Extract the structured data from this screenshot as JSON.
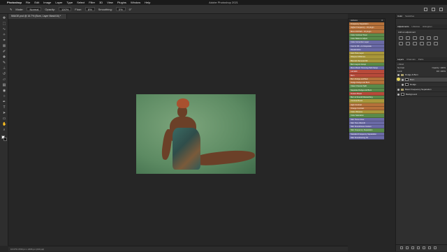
{
  "menubar": {
    "apple": "",
    "items": [
      "Photoshop",
      "File",
      "Edit",
      "Image",
      "Layer",
      "Type",
      "Select",
      "Filter",
      "3D",
      "View",
      "Plugins",
      "Window",
      "Help"
    ],
    "app_title": "Adobe Photoshop 2021"
  },
  "options_bar": {
    "mode_label": "Mode:",
    "mode_value": "Normal",
    "opacity_label": "Opacity:",
    "opacity_value": "100%",
    "flow_label": "Flow:",
    "flow_value": "8%",
    "smoothing_label": "Smoothing:",
    "smoothing_value": "0%",
    "angle_value": "0°"
  },
  "document": {
    "tab_title": "IMAGE.psd @ 16.7% (Burn, Layer Mask/16) *",
    "status": "16.67%   3700 px x 2466 px (240 ppi)"
  },
  "actions_panel": {
    "title": "Actions",
    "items": [
      {
        "label": "Frequency Separation",
        "color": "#b5713a"
      },
      {
        "label": "Higher Frequency - 16 plugin",
        "color": "#b5713a"
      },
      {
        "label": "Mono Fill Path - 16 plugin",
        "color": "#b5713a"
      },
      {
        "label": "Color Contrast Toner",
        "color": "#5a8a4a"
      },
      {
        "label": "Color Balance Adjust",
        "color": "#5a8a4a"
      },
      {
        "label": "Color Correction Layer",
        "color": "#6a6aa6"
      },
      {
        "label": "Cool to Fill + to Grayscale",
        "color": "#6a6aa6"
      },
      {
        "label": "Desaturation",
        "color": "#6a6aa6"
      },
      {
        "label": "Auto Tone Layer",
        "color": "#a8963a"
      },
      {
        "label": "Sharpen Midtones",
        "color": "#a8963a"
      },
      {
        "label": "Blemish Removal Fill",
        "color": "#a8963a"
      },
      {
        "label": "Burn Layers Group",
        "color": "#5a8a4a"
      },
      {
        "label": "Mono Brush Trimming Path Setup",
        "color": "#6a6aa6"
      },
      {
        "label": "Lab Edit",
        "color": "#b84a3a"
      },
      {
        "label": "Burn",
        "color": "#b84a3a"
      },
      {
        "label": "Burn Dodge and Burn",
        "color": "#b5713a"
      },
      {
        "label": "Dodge Dodge and Burn",
        "color": "#b5713a"
      },
      {
        "label": "Clean Channel Split",
        "color": "#5a8a4a"
      },
      {
        "label": "Separate Dodge and Burn",
        "color": "#5a8a4a"
      },
      {
        "label": "Texture Boost",
        "color": "#b84a3a"
      },
      {
        "label": "Burn & Smooth Retouching",
        "color": "#5a8a4a"
      },
      {
        "label": "Contrast Boost",
        "color": "#a8963a"
      },
      {
        "label": "High Contrast",
        "color": "#b5713a"
      },
      {
        "label": "Orange Contrast",
        "color": "#b5713a"
      },
      {
        "label": "Color Vibrance",
        "color": "#a8963a"
      },
      {
        "label": "Color Saturation",
        "color": "#5a8a4a"
      },
      {
        "label": "Skin Tones Glow",
        "color": "#6a6aa6"
      },
      {
        "label": "Skin Tone Warmth",
        "color": "#6a6aa6"
      },
      {
        "label": "Skin Smoothness Custom",
        "color": "#6a6aa6"
      },
      {
        "label": "Skin Frequency Separation",
        "color": "#5a8a4a"
      },
      {
        "label": "Standard Frequency Separation",
        "color": "#6a6aa6"
      },
      {
        "label": "Skin Smoothening FS",
        "color": "#6a6aa6"
      }
    ]
  },
  "right_panel": {
    "tabs": [
      "Color",
      "Swatches"
    ],
    "adjust_tabs": [
      "Adjustments",
      "Libraries",
      "Histogram"
    ],
    "adjust_title": "Add an adjustment",
    "layers_tabs": [
      "Layers",
      "Channels",
      "Paths"
    ],
    "blend_mode": "Normal",
    "opacity_label": "Opacity: 100%",
    "fill_label": "Fill: 100%",
    "lock_label": "Lock:",
    "layers": [
      {
        "name": "Dodge & Burn",
        "type": "group",
        "selected": false
      },
      {
        "name": "Burn",
        "type": "layer",
        "selected": true
      },
      {
        "name": "Dodge",
        "type": "layer",
        "selected": false
      },
      {
        "name": "Basic Frequency Separation",
        "type": "group",
        "selected": false
      },
      {
        "name": "Background",
        "type": "layer",
        "selected": false
      }
    ]
  },
  "colors": {
    "accent": "#e6d65a"
  }
}
